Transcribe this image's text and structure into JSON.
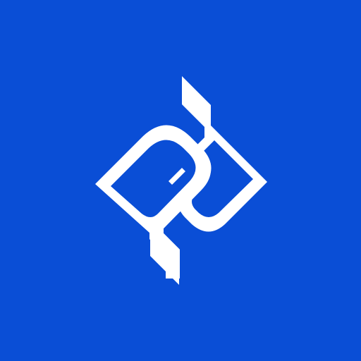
{
  "app": {
    "background_color": "#0a4ed6",
    "logo_color": "#ffffff",
    "icon": "pd-monogram-logo-icon"
  }
}
